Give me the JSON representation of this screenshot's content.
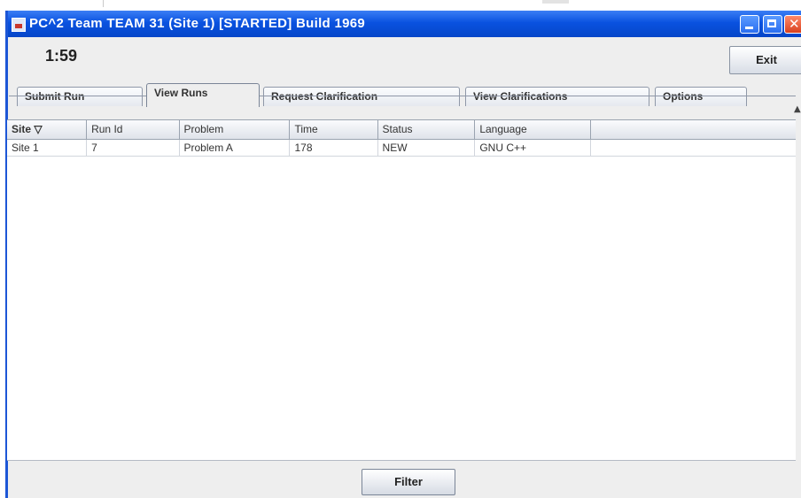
{
  "window": {
    "title": "PC^2 Team TEAM 31 (Site 1) [STARTED] Build 1969"
  },
  "header": {
    "clock": "1:59",
    "exit_label": "Exit"
  },
  "tabs": [
    {
      "label": "Submit Run",
      "active": false
    },
    {
      "label": "View Runs",
      "active": true
    },
    {
      "label": "Request Clarification",
      "active": false
    },
    {
      "label": "View Clarifications",
      "active": false
    },
    {
      "label": "Options",
      "active": false
    }
  ],
  "table": {
    "columns": [
      "Site ▽",
      "Run Id",
      "Problem",
      "Time",
      "Status",
      "Language",
      ""
    ],
    "rows": [
      [
        "Site 1",
        "7",
        "Problem A",
        "178",
        "NEW",
        "GNU C++",
        ""
      ]
    ]
  },
  "footer": {
    "filter_label": "Filter"
  },
  "colors": {
    "titlebar": "#0a52e0",
    "window_bg": "#eeeeee",
    "close_button": "#d8401e"
  },
  "icons": [
    "app-icon",
    "minimize-icon",
    "maximize-icon",
    "close-icon",
    "sort-arrow-icon"
  ]
}
